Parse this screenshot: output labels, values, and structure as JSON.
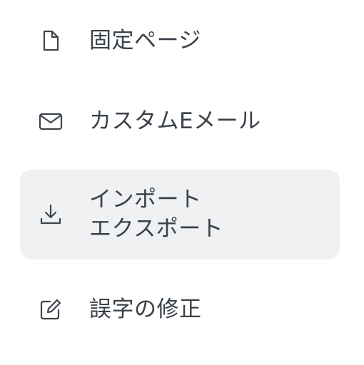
{
  "menu": {
    "items": [
      {
        "label": "固定ページ",
        "icon": "page-icon"
      },
      {
        "label": "カスタムEメール",
        "icon": "mail-icon"
      },
      {
        "label": "インポート\nエクスポート",
        "icon": "download-icon",
        "selected": true
      },
      {
        "label": "誤字の修正",
        "icon": "edit-icon"
      }
    ]
  },
  "colors": {
    "text": "#3a4149",
    "icon": "#3d444c",
    "selected_bg": "#f0f1f3"
  }
}
